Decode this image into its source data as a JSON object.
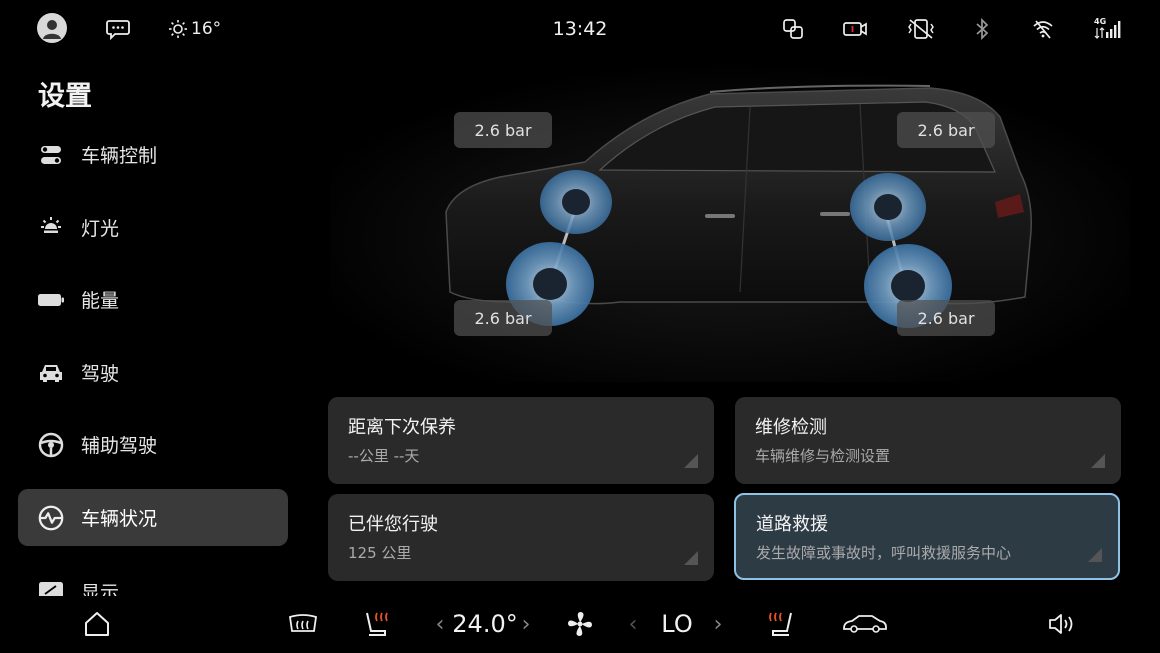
{
  "status_bar": {
    "time": "13:42",
    "weather_temp": "16°",
    "icons": [
      "avatar-icon",
      "message-icon",
      "sun-icon",
      "screen-mirror-icon",
      "dashcam-icon",
      "vibration-off-icon",
      "bluetooth-icon",
      "wifi-off-icon",
      "4g-signal-icon"
    ],
    "signal_label": "4G"
  },
  "sidebar": {
    "title": "设置",
    "items": [
      {
        "label": "车辆控制",
        "icon": "toggle-icon"
      },
      {
        "label": "灯光",
        "icon": "light-icon"
      },
      {
        "label": "能量",
        "icon": "battery-icon"
      },
      {
        "label": "驾驶",
        "icon": "car-front-icon"
      },
      {
        "label": "辅助驾驶",
        "icon": "steering-wheel-icon"
      },
      {
        "label": "车辆状况",
        "icon": "vehicle-status-icon",
        "active": true
      },
      {
        "label": "显示",
        "icon": "display-icon"
      }
    ]
  },
  "tire_pressure": {
    "front_left": "2.6 bar",
    "rear_left": "2.6 bar",
    "front_right": "2.6 bar",
    "rear_right": "2.6 bar"
  },
  "cards": [
    {
      "title": "距离下次保养",
      "subtitle": "--公里 --天"
    },
    {
      "title": "维修检测",
      "subtitle": "车辆维修与检测设置"
    },
    {
      "title": "已伴您行驶",
      "subtitle": "125 公里"
    },
    {
      "title": "道路救援",
      "subtitle": "发生故障或事故时，呼叫救援服务中心",
      "highlighted": true
    }
  ],
  "climate_bar": {
    "driver_temp": "24.0°",
    "passenger_temp": "LO",
    "icons": [
      "home-icon",
      "rear-defrost-icon",
      "seat-heat-icon",
      "fan-icon",
      "seat-heat-right-icon",
      "car-side-icon",
      "volume-icon"
    ]
  },
  "colors": {
    "accent": "#8fc3e6",
    "card_bg": "#2a2a2a",
    "active_nav_bg": "#3a3a3a"
  }
}
